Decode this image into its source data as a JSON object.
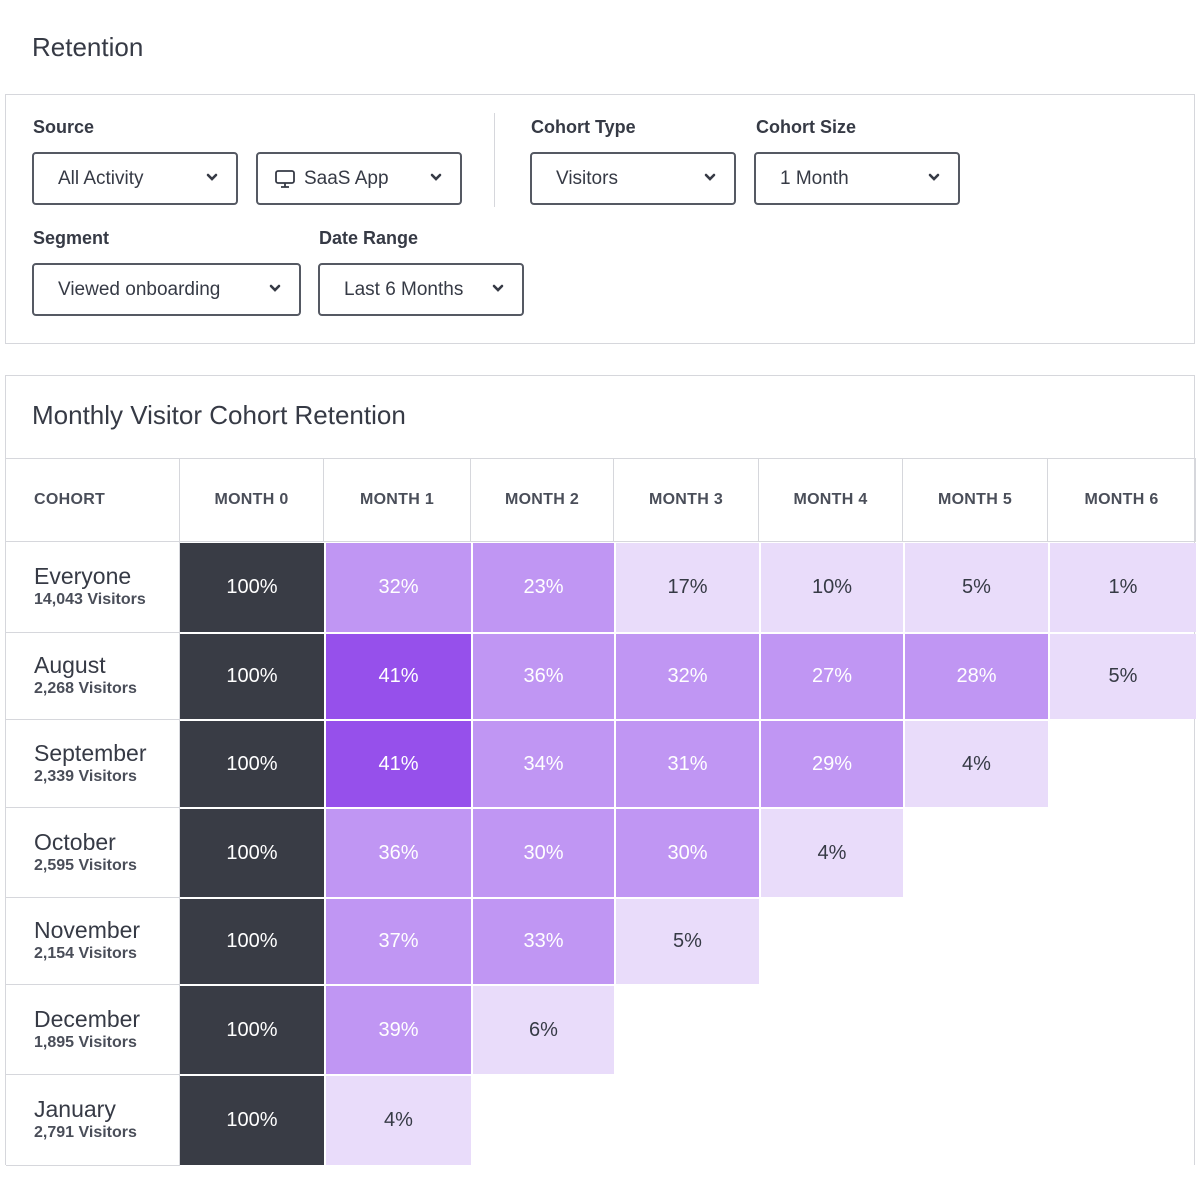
{
  "page": {
    "title": "Retention"
  },
  "filters": {
    "source": {
      "label": "Source",
      "activity_value": "All Activity",
      "app_value": "SaaS App",
      "app_icon": "monitor-icon"
    },
    "cohort_type": {
      "label": "Cohort Type",
      "value": "Visitors"
    },
    "cohort_size": {
      "label": "Cohort Size",
      "value": "1 Month"
    },
    "segment": {
      "label": "Segment",
      "value": "Viewed onboarding"
    },
    "date_range": {
      "label": "Date Range",
      "value": "Last 6 Months"
    }
  },
  "colors": {
    "month0": "#393c45",
    "high": "#9650eb",
    "mid": "#c096f3",
    "low": "#e9dcfa",
    "text_dark": "#363a45",
    "text_light": "#ffffff"
  },
  "chart_data": {
    "type": "heatmap",
    "title": "Monthly Visitor Cohort Retention",
    "row_header": "COHORT",
    "columns": [
      "MONTH 0",
      "MONTH 1",
      "MONTH 2",
      "MONTH 3",
      "MONTH 4",
      "MONTH 5",
      "MONTH 6"
    ],
    "rows": [
      {
        "name": "Everyone",
        "count": "14,043 Visitors",
        "values": [
          100,
          32,
          23,
          17,
          10,
          5,
          1
        ]
      },
      {
        "name": "August",
        "count": "2,268 Visitors",
        "values": [
          100,
          41,
          36,
          32,
          27,
          28,
          5
        ]
      },
      {
        "name": "September",
        "count": "2,339 Visitors",
        "values": [
          100,
          41,
          34,
          31,
          29,
          4
        ]
      },
      {
        "name": "October",
        "count": "2,595 Visitors",
        "values": [
          100,
          36,
          30,
          30,
          4
        ]
      },
      {
        "name": "November",
        "count": "2,154 Visitors",
        "values": [
          100,
          37,
          33,
          5
        ]
      },
      {
        "name": "December",
        "count": "1,895 Visitors",
        "values": [
          100,
          39,
          6
        ]
      },
      {
        "name": "January",
        "count": "2,791 Visitors",
        "values": [
          100,
          4
        ]
      }
    ],
    "value_suffix": "%"
  }
}
